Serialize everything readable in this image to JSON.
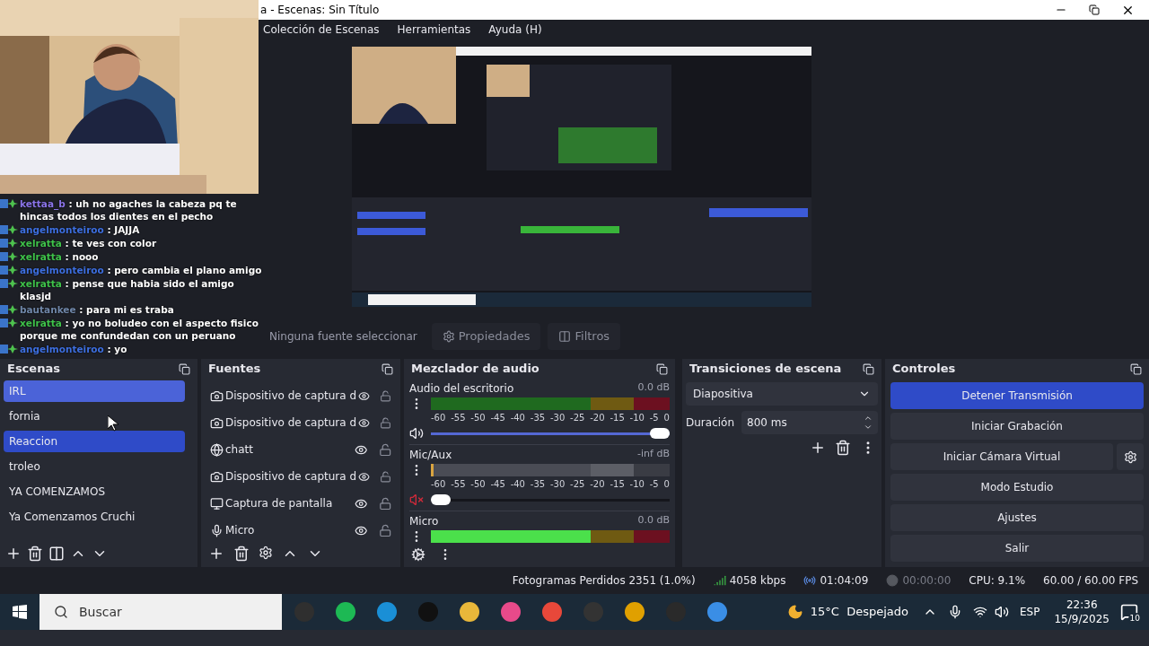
{
  "window": {
    "title": "a - Escenas: Sin Título"
  },
  "menu": [
    "Colección de Escenas",
    "Herramientas",
    "Ayuda (H)"
  ],
  "chat": [
    {
      "user": "kettaa_b",
      "color": "#8a74e8",
      "text": ": uh no agaches la cabeza pq te hincas todos los dientes en el pecho"
    },
    {
      "user": "angelmonteiroo",
      "color": "#3d6fe0",
      "text": ": JAJJA"
    },
    {
      "user": "xelratta",
      "color": "#3fc24a",
      "text": ": te ves con color"
    },
    {
      "user": "xelratta",
      "color": "#3fc24a",
      "text": ": nooo"
    },
    {
      "user": "angelmonteiroo",
      "color": "#3d6fe0",
      "text": ": pero cambia el plano amigo"
    },
    {
      "user": "xelratta",
      "color": "#3fc24a",
      "text": ": pense que habia sido el amigo klasjd"
    },
    {
      "user": "bautankee",
      "color": "#6f86a8",
      "text": ": para mi es traba"
    },
    {
      "user": "xelratta",
      "color": "#3fc24a",
      "text": ": yo no boludeo con el aspecto fisico porque me confundedan con un peruano"
    },
    {
      "user": "angelmonteiroo",
      "color": "#3d6fe0",
      "text": ": yo"
    }
  ],
  "source_toolbar": {
    "status": "Ninguna fuente seleccionar",
    "buttons": [
      "Propiedades",
      "Filtros"
    ]
  },
  "scenes": {
    "title": "Escenas",
    "items": [
      {
        "name": "IRL",
        "selected": true,
        "hovered": true
      },
      {
        "name": "fornia",
        "selected": false,
        "hovered": false
      },
      {
        "name": "Reaccion",
        "selected": true,
        "hovered": false
      },
      {
        "name": "troleo",
        "selected": false,
        "hovered": false
      },
      {
        "name": "YA COMENZAMOS",
        "selected": false,
        "hovered": false
      },
      {
        "name": "Ya Comenzamos Cruchi",
        "selected": false,
        "hovered": false
      }
    ]
  },
  "sources": {
    "title": "Fuentes",
    "items": [
      {
        "kind": "camera",
        "name": "Dispositivo de captura d",
        "visible": true,
        "locked": false
      },
      {
        "kind": "camera",
        "name": "Dispositivo de captura d",
        "visible": true,
        "locked": false
      },
      {
        "kind": "browser",
        "name": "chatt",
        "visible": true,
        "locked": false
      },
      {
        "kind": "camera",
        "name": "Dispositivo de captura d",
        "visible": true,
        "locked": false
      },
      {
        "kind": "display",
        "name": "Captura de pantalla",
        "visible": true,
        "locked": false
      },
      {
        "kind": "audio",
        "name": "Micro",
        "visible": true,
        "locked": false
      }
    ]
  },
  "mixer": {
    "title": "Mezclador de audio",
    "channels": [
      {
        "name": "Audio del escritorio",
        "reading": "0.0 dB",
        "muted": false,
        "meter": {
          "level": 0
        },
        "volume": {
          "level": 1
        },
        "ticks": [
          "-60",
          "-55",
          "-50",
          "-45",
          "-40",
          "-35",
          "-30",
          "-25",
          "-20",
          "-15",
          "-10",
          "-5",
          "0"
        ]
      },
      {
        "name": "Mic/Aux",
        "reading": "-inf dB",
        "muted": true,
        "meter": {
          "level": 0.01
        },
        "volume": {
          "level": 0
        },
        "ticks": [
          "-60",
          "-55",
          "-50",
          "-45",
          "-40",
          "-35",
          "-30",
          "-25",
          "-20",
          "-15",
          "-10",
          "-5",
          "0"
        ]
      },
      {
        "name": "Micro",
        "reading": "0.0 dB",
        "meter": {
          "level": 0.68
        }
      }
    ]
  },
  "transitions": {
    "title": "Transiciones de escena",
    "type": "Diapositiva",
    "duration_label": "Duración",
    "duration": "800 ms"
  },
  "controls": {
    "title": "Controles",
    "buttons": [
      {
        "label": "Detener Transmisión",
        "active": true
      },
      {
        "label": "Iniciar Grabación",
        "active": false
      },
      {
        "label": "Iniciar Cámara Virtual",
        "active": false
      },
      {
        "label": "Modo Estudio",
        "active": false
      },
      {
        "label": "Ajustes",
        "active": false
      },
      {
        "label": "Salir",
        "active": false
      }
    ]
  },
  "status_bar": {
    "dropped": "Fotogramas Perdidos 2351 (1.0%)",
    "bitrate": "4058 kbps",
    "stream_time": "01:04:09",
    "record_time": "00:00:00",
    "cpu": "CPU: 9.1%",
    "fps": "60.00 / 60.00 FPS"
  },
  "taskbar": {
    "search_placeholder": "Buscar",
    "weather": "15°C  Despejado",
    "language": "ESP",
    "time": "22:36",
    "date": "15/9/2025",
    "notifications": "10"
  }
}
